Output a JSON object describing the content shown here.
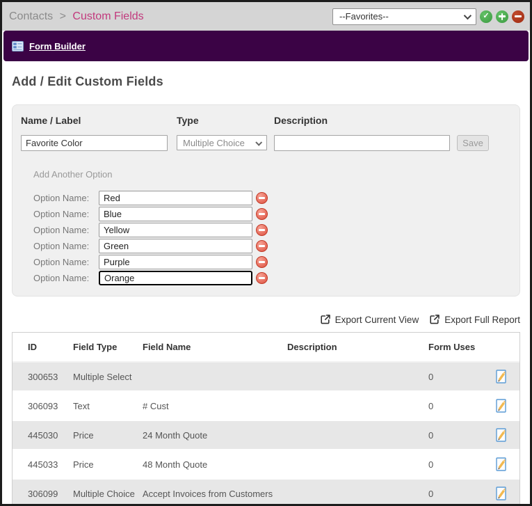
{
  "breadcrumb": {
    "section": "Contacts",
    "separator": ">",
    "page": "Custom Fields"
  },
  "topbar": {
    "favorites_value": "--Favorites--",
    "check_glyph": "✓"
  },
  "nav": {
    "form_builder_label": "Form Builder"
  },
  "heading": "Add / Edit Custom Fields",
  "form": {
    "name_label": "Name / Label",
    "name_value": "Favorite Color",
    "type_label": "Type",
    "type_value": "Multiple Choice",
    "description_label": "Description",
    "description_value": "",
    "save_label": "Save",
    "add_option_label": "Add Another Option",
    "option_label": "Option Name:",
    "options": [
      "Red",
      "Blue",
      "Yellow",
      "Green",
      "Purple",
      "Orange"
    ]
  },
  "export": {
    "current_view_label": "Export Current View",
    "full_report_label": "Export Full Report"
  },
  "table": {
    "headers": [
      "ID",
      "Field Type",
      "Field Name",
      "Description",
      "Form Uses"
    ],
    "rows": [
      {
        "id": "300653",
        "field_type": "Multiple Select",
        "field_name": "",
        "description": "",
        "form_uses": "0"
      },
      {
        "id": "306093",
        "field_type": "Text",
        "field_name": "# Cust",
        "description": "",
        "form_uses": "0"
      },
      {
        "id": "445030",
        "field_type": "Price",
        "field_name": "24 Month Quote",
        "description": "",
        "form_uses": "0"
      },
      {
        "id": "445033",
        "field_type": "Price",
        "field_name": "48 Month Quote",
        "description": "",
        "form_uses": "0"
      },
      {
        "id": "306099",
        "field_type": "Multiple Choice",
        "field_name": "Accept Invoices from Customers",
        "description": "",
        "form_uses": "0"
      }
    ]
  },
  "colors": {
    "accent_pink": "#c23a7d",
    "nav_purple": "#3b0345",
    "icon_green": "#3b9a40",
    "icon_red": "#9e2a10",
    "remove_salmon": "#dd5140",
    "topbar_gray": "#d5d5d5",
    "panel_gray": "#f0f0f0",
    "row_alt_gray": "#e7e7e7"
  }
}
